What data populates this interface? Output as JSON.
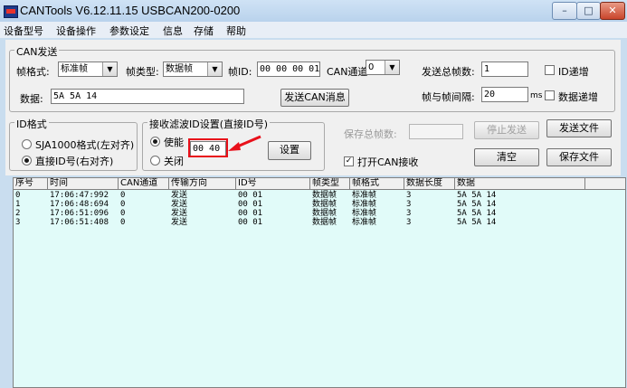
{
  "window": {
    "title": "CANTools V6.12.11.15  USBCAN200-0200",
    "controls": {
      "minimize": "–",
      "maximize": "□",
      "close": "✕"
    }
  },
  "menu": [
    "设备型号",
    "设备操作",
    "参数设定",
    "信息",
    "存储",
    "帮助"
  ],
  "can_send": {
    "group_label": "CAN发送",
    "frame_format_label": "帧格式:",
    "frame_format_value": "标准帧",
    "frame_type_label": "帧类型:",
    "frame_type_value": "数据帧",
    "frame_id_label": "帧ID:",
    "frame_id_value": "00 00 00 01",
    "can_channel_label": "CAN通道:",
    "can_channel_value": "0",
    "send_count_label": "发送总帧数:",
    "send_count_value": "1",
    "id_increment_label": "ID递增",
    "data_label": "数据:",
    "data_value": "5A 5A 14",
    "send_button": "发送CAN消息",
    "interval_label": "帧与帧间隔:",
    "interval_value": "20",
    "interval_unit": "ms",
    "data_increment_label": "数据递增"
  },
  "id_format": {
    "group_label": "ID格式",
    "option1": "SJA1000格式(左对齐)",
    "option2": "直接ID号(右对齐)",
    "selected": 2
  },
  "filter": {
    "group_label": "接收滤波ID设置(直接ID号)",
    "enable_label": "使能",
    "disable_label": "关闭",
    "enabled": true,
    "id_value": "00 40",
    "set_button": "设置"
  },
  "save": {
    "save_total_label": "保存总帧数:",
    "save_total_value": "",
    "stop_send_button": "停止发送",
    "send_file_button": "发送文件",
    "open_receive_label": "打开CAN接收",
    "open_receive_checked": true,
    "clear_button": "清空",
    "save_file_button": "保存文件"
  },
  "table": {
    "columns": [
      "序号",
      "时间",
      "CAN通道",
      "传输方向",
      "ID号",
      "帧类型",
      "帧格式",
      "数据长度",
      "数据"
    ],
    "rows": [
      [
        "0",
        "17:06:47:992",
        "0",
        "发送",
        "00 01",
        "数据帧",
        "标准帧",
        "3",
        "5A 5A 14"
      ],
      [
        "1",
        "17:06:48:694",
        "0",
        "发送",
        "00 01",
        "数据帧",
        "标准帧",
        "3",
        "5A 5A 14"
      ],
      [
        "2",
        "17:06:51:096",
        "0",
        "发送",
        "00 01",
        "数据帧",
        "标准帧",
        "3",
        "5A 5A 14"
      ],
      [
        "3",
        "17:06:51:408",
        "0",
        "发送",
        "00 01",
        "数据帧",
        "标准帧",
        "3",
        "5A 5A 14"
      ]
    ]
  },
  "colors": {
    "highlight_box": "#e8101a",
    "annotation_arrow": "#e8101a",
    "grid_background": "#e1fbf9"
  }
}
